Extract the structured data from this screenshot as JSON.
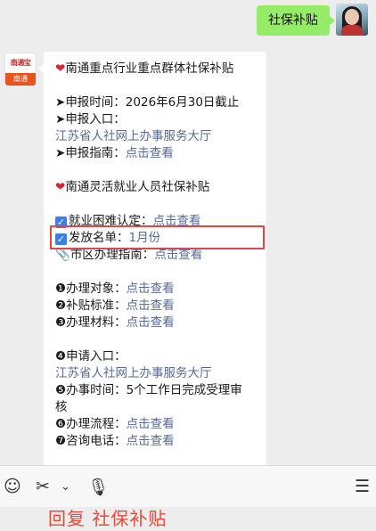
{
  "user_message": "社保补贴",
  "bot_avatar": {
    "logo_text": "南通宝",
    "tag_text": "南通"
  },
  "message": {
    "lines": [
      {
        "type": "heart",
        "text": "南通重点行业重点群体社保补贴"
      },
      {
        "type": "gap"
      },
      {
        "type": "arrow",
        "text": "申报时间：2026年6月30日截止"
      },
      {
        "type": "arrow",
        "text": "申报入口："
      },
      {
        "type": "link",
        "text": "江苏省人社网上办事服务大厅"
      },
      {
        "type": "arrow",
        "text": "申报指南：",
        "link": "点击查看"
      },
      {
        "type": "gap"
      },
      {
        "type": "heart",
        "text": "南通灵活就业人员社保补贴"
      },
      {
        "type": "gap"
      },
      {
        "type": "check",
        "text": "就业困难认定：",
        "link": "点击查看"
      },
      {
        "type": "check",
        "text": "发放名单：",
        "link": "1月份"
      },
      {
        "type": "pin",
        "text": "市区办理指南：",
        "link": "点击查看"
      },
      {
        "type": "gap"
      },
      {
        "type": "num",
        "num": "1",
        "text": "办理对象：",
        "link": "点击查看"
      },
      {
        "type": "num",
        "num": "2",
        "text": "补贴标准：",
        "link": "点击查看"
      },
      {
        "type": "num",
        "num": "3",
        "text": "办理材料：",
        "link": "点击查看"
      },
      {
        "type": "gap"
      },
      {
        "type": "num",
        "num": "4",
        "text": "申请入口："
      },
      {
        "type": "link",
        "text": "江苏省人社网上办事服务大厅"
      },
      {
        "type": "num",
        "num": "5",
        "text": "办事时间：5个工作日完成受理审"
      },
      {
        "type": "plain",
        "text": "核"
      },
      {
        "type": "num",
        "num": "6",
        "text": "办理流程：",
        "link": "点击查看"
      },
      {
        "type": "num",
        "num": "7",
        "text": "咨询电话：",
        "link": "点击查看"
      }
    ]
  },
  "toolbar": {
    "icons": [
      "emoji-icon",
      "scissors-icon",
      "chevron-down-icon",
      "microphone-icon",
      "menu-icon"
    ]
  },
  "caption": "回复 社保补贴",
  "colors": {
    "me_bubble": "#95ec69",
    "link": "#576b95",
    "highlight": "#e34646",
    "caption": "#e34a3a"
  }
}
